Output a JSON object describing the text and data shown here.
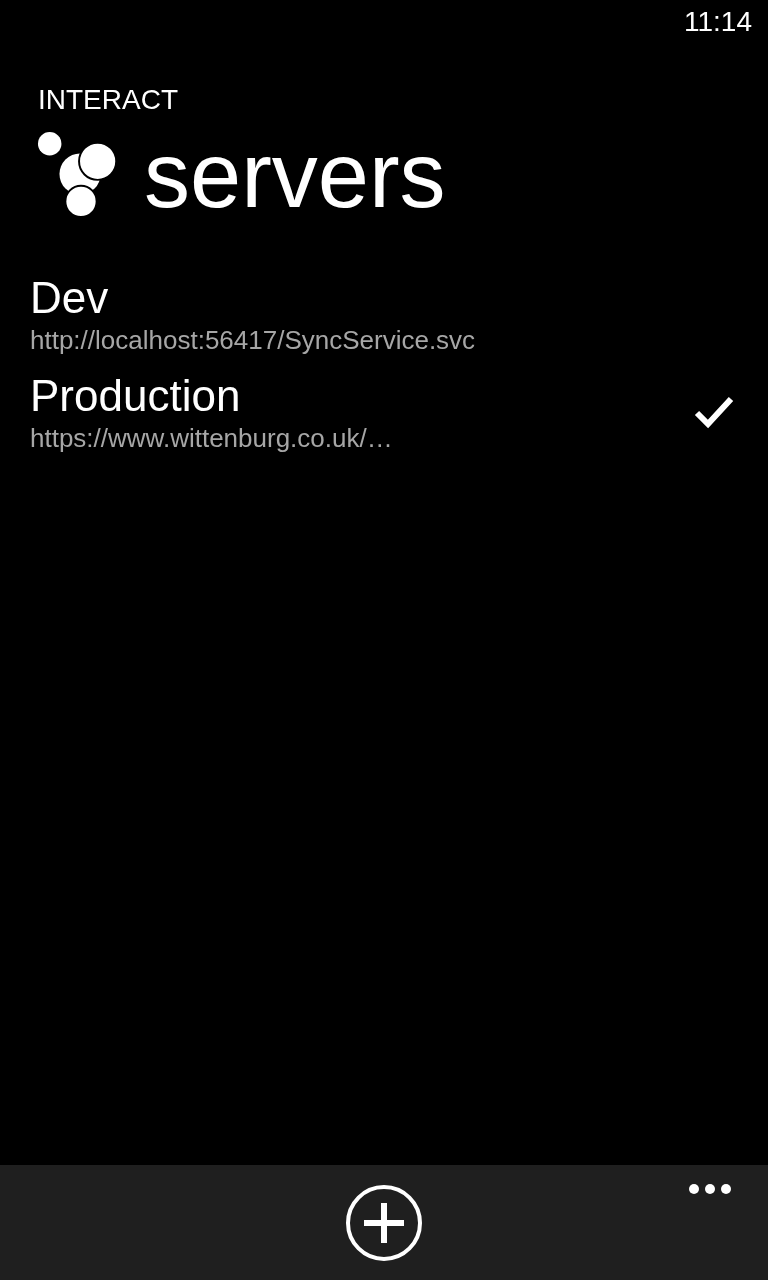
{
  "status_bar": {
    "time": "11:14"
  },
  "app_title": "INTERACT",
  "page_title": "servers",
  "servers": [
    {
      "name": "Dev",
      "url": "http://localhost:56417/SyncService.svc",
      "selected": false
    },
    {
      "name": "Production",
      "url": "https://www.wittenburg.co.uk/…",
      "selected": true
    }
  ]
}
